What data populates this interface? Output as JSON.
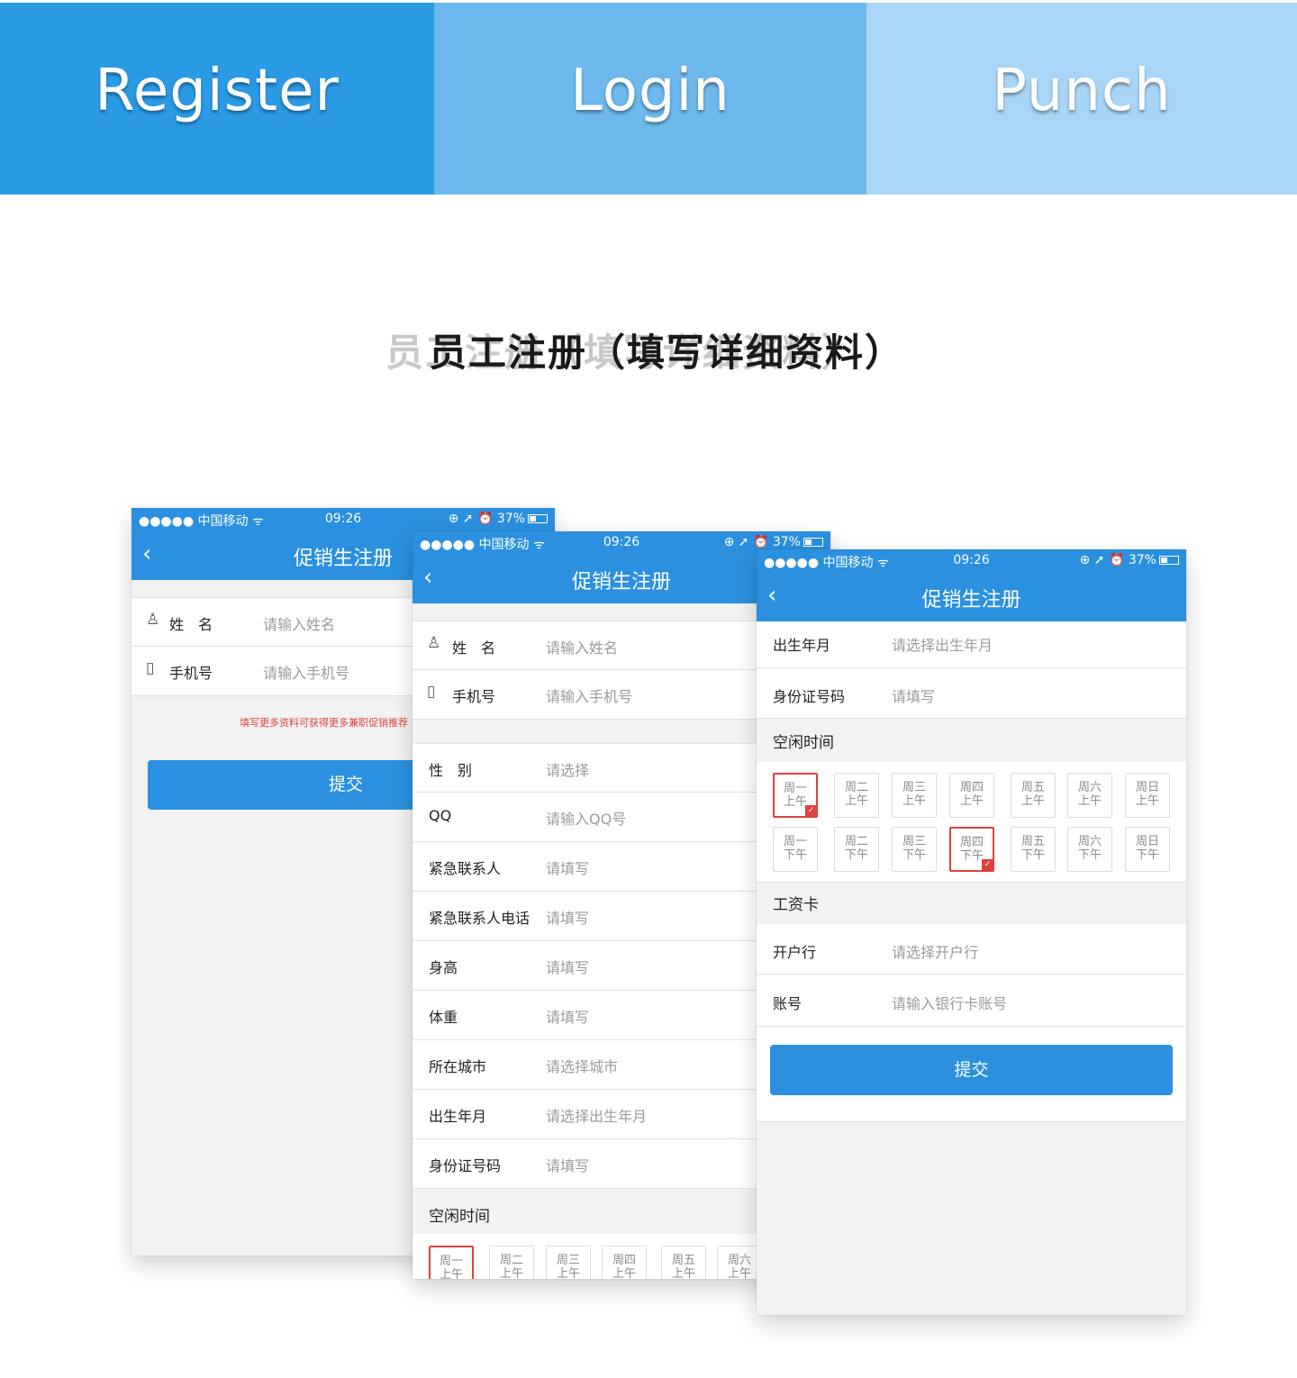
{
  "tabs": [
    {
      "label": "Register",
      "color": "#2a9ae5"
    },
    {
      "label": "Login",
      "color": "#6db8ec"
    },
    {
      "label": "Punch",
      "color": "#a9d6f6"
    }
  ],
  "heading": {
    "ghost": "员工注册（填写详细资料）",
    "text": "员工注册（填写详细资料）"
  },
  "status": {
    "carrier": "●●●●● 中国移动",
    "wifi": "ᯤ",
    "time": "09:26",
    "right": "⊕ ➚ ⏰ 37%"
  },
  "nav": {
    "back": "‹",
    "title": "促销生注册"
  },
  "phone1": {
    "rows": [
      {
        "label": "姓　名",
        "placeholder": "请输入姓名",
        "icon": "person-icon",
        "glyph": "♙"
      },
      {
        "label": "手机号",
        "placeholder": "请输入手机号",
        "icon": "phone-icon",
        "glyph": "▯"
      }
    ],
    "note": "填写更多资料可获得更多兼职促销推荐",
    "submit": "提交"
  },
  "phone2": {
    "rows": [
      {
        "label": "姓　名",
        "placeholder": "请输入姓名",
        "icon": "person-icon",
        "glyph": "♙"
      },
      {
        "label": "手机号",
        "placeholder": "请输入手机号",
        "icon": "phone-icon",
        "glyph": "▯"
      },
      {
        "label": "性　别",
        "placeholder": "请选择"
      },
      {
        "label": "QQ",
        "placeholder": "请输入QQ号"
      },
      {
        "label": "紧急联系人",
        "placeholder": "请填写"
      },
      {
        "label": "紧急联系人电话",
        "placeholder": "请填写"
      },
      {
        "label": "身高",
        "placeholder": "请填写"
      },
      {
        "label": "体重",
        "placeholder": "请填写"
      },
      {
        "label": "所在城市",
        "placeholder": "请选择城市"
      },
      {
        "label": "出生年月",
        "placeholder": "请选择出生年月"
      },
      {
        "label": "身份证号码",
        "placeholder": "请填写"
      }
    ],
    "free_time": "空闲时间",
    "slots": [
      {
        "day": "周一",
        "time": "上午",
        "selected": true
      },
      {
        "day": "周二",
        "time": "上午",
        "selected": false
      },
      {
        "day": "周三",
        "time": "上午",
        "selected": false
      },
      {
        "day": "周四",
        "time": "上午",
        "selected": false
      },
      {
        "day": "周五",
        "time": "上午",
        "selected": false
      },
      {
        "day": "周六",
        "time": "上午",
        "selected": false
      }
    ]
  },
  "phone3": {
    "rows_top": [
      {
        "label": "出生年月",
        "placeholder": "请选择出生年月"
      },
      {
        "label": "身份证号码",
        "placeholder": "请填写"
      }
    ],
    "free_time": "空闲时间",
    "slots_am": [
      {
        "day": "周一",
        "time": "上午",
        "selected": true
      },
      {
        "day": "周二",
        "time": "上午",
        "selected": false
      },
      {
        "day": "周三",
        "time": "上午",
        "selected": false
      },
      {
        "day": "周四",
        "time": "上午",
        "selected": false
      },
      {
        "day": "周五",
        "time": "上午",
        "selected": false
      },
      {
        "day": "周六",
        "time": "上午",
        "selected": false
      },
      {
        "day": "周日",
        "time": "上午",
        "selected": false
      }
    ],
    "slots_pm": [
      {
        "day": "周一",
        "time": "下午",
        "selected": false
      },
      {
        "day": "周二",
        "time": "下午",
        "selected": false
      },
      {
        "day": "周三",
        "time": "下午",
        "selected": false
      },
      {
        "day": "周四",
        "time": "下午",
        "selected": true
      },
      {
        "day": "周五",
        "time": "下午",
        "selected": false
      },
      {
        "day": "周六",
        "time": "下午",
        "selected": false
      },
      {
        "day": "周日",
        "time": "下午",
        "selected": false
      }
    ],
    "salary_card": "工资卡",
    "rows_bank": [
      {
        "label": "开户行",
        "placeholder": "请选择开户行"
      },
      {
        "label": "账号",
        "placeholder": "请输入银行卡账号"
      }
    ],
    "submit": "提交"
  },
  "colors": {
    "primary": "#2a90df",
    "selected": "#e0413c"
  },
  "check": "✓"
}
